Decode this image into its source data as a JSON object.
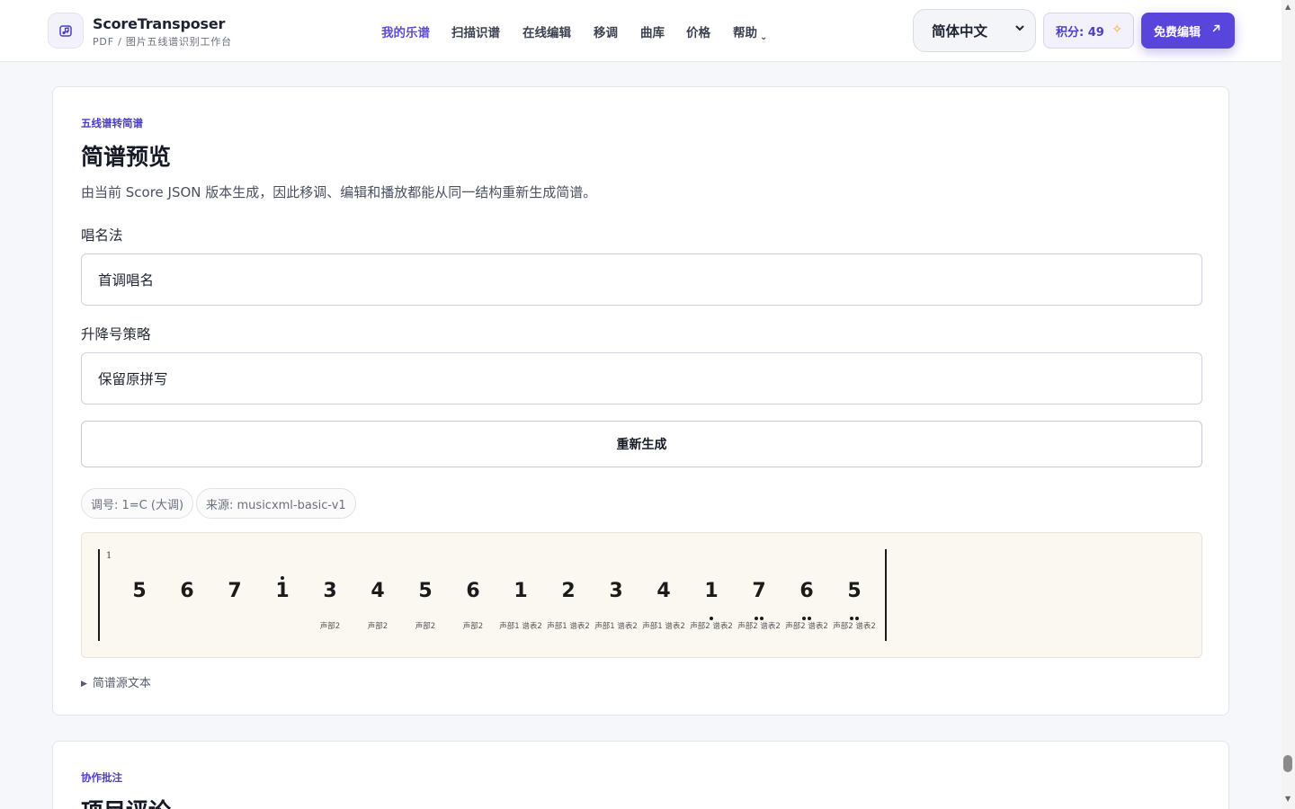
{
  "brand": {
    "name": "ScoreTransposer",
    "subtitle": "PDF / 图片五线谱识别工作台",
    "logo_icon": "music-note-icon"
  },
  "nav": {
    "items": [
      {
        "label": "我的乐谱",
        "active": true
      },
      {
        "label": "扫描识谱",
        "active": false
      },
      {
        "label": "在线编辑",
        "active": false
      },
      {
        "label": "移调",
        "active": false
      },
      {
        "label": "曲库",
        "active": false
      },
      {
        "label": "价格",
        "active": false
      },
      {
        "label": "帮助",
        "active": false,
        "has_dropdown": true
      }
    ]
  },
  "header": {
    "language": "简体中文",
    "points": "积分: 49",
    "free_button": "免费编辑",
    "accent_color": "#5a45dc"
  },
  "preview": {
    "eyebrow": "五线谱转简谱",
    "title": "简谱预览",
    "description": "由当前 Score JSON 版本生成，因此移调、编辑和播放都能从同一结构重新生成简谱。",
    "solfege_label": "唱名法",
    "solfege_value": "首调唱名",
    "accidental_label": "升降号策略",
    "accidental_value": "保留原拼写",
    "regenerate_button": "重新生成",
    "chips": [
      "调号: 1=C (大调)",
      "来源: musicxml-basic-v1"
    ],
    "source_toggle": "简谱源文本"
  },
  "score": {
    "measure_number": "1",
    "notes": [
      {
        "digit": "5",
        "octave": 0,
        "voice": ""
      },
      {
        "digit": "6",
        "octave": 0,
        "voice": ""
      },
      {
        "digit": "7",
        "octave": 0,
        "voice": ""
      },
      {
        "digit": "1",
        "octave": 1,
        "voice": ""
      },
      {
        "digit": "3",
        "octave": 0,
        "voice": "声部2"
      },
      {
        "digit": "4",
        "octave": 0,
        "voice": "声部2"
      },
      {
        "digit": "5",
        "octave": 0,
        "voice": "声部2"
      },
      {
        "digit": "6",
        "octave": 0,
        "voice": "声部2"
      },
      {
        "digit": "1",
        "octave": 0,
        "voice": "声部1 谱表2"
      },
      {
        "digit": "2",
        "octave": 0,
        "voice": "声部1 谱表2"
      },
      {
        "digit": "3",
        "octave": 0,
        "voice": "声部1 谱表2"
      },
      {
        "digit": "4",
        "octave": 0,
        "voice": "声部1 谱表2"
      },
      {
        "digit": "1",
        "octave": -1,
        "voice": "声部2 谱表2"
      },
      {
        "digit": "7",
        "octave": -2,
        "voice": "声部2 谱表2"
      },
      {
        "digit": "6",
        "octave": -2,
        "voice": "声部2 谱表2"
      },
      {
        "digit": "5",
        "octave": -2,
        "voice": "声部2 谱表2"
      }
    ]
  },
  "comments": {
    "eyebrow": "协作批注",
    "title": "项目评论"
  }
}
